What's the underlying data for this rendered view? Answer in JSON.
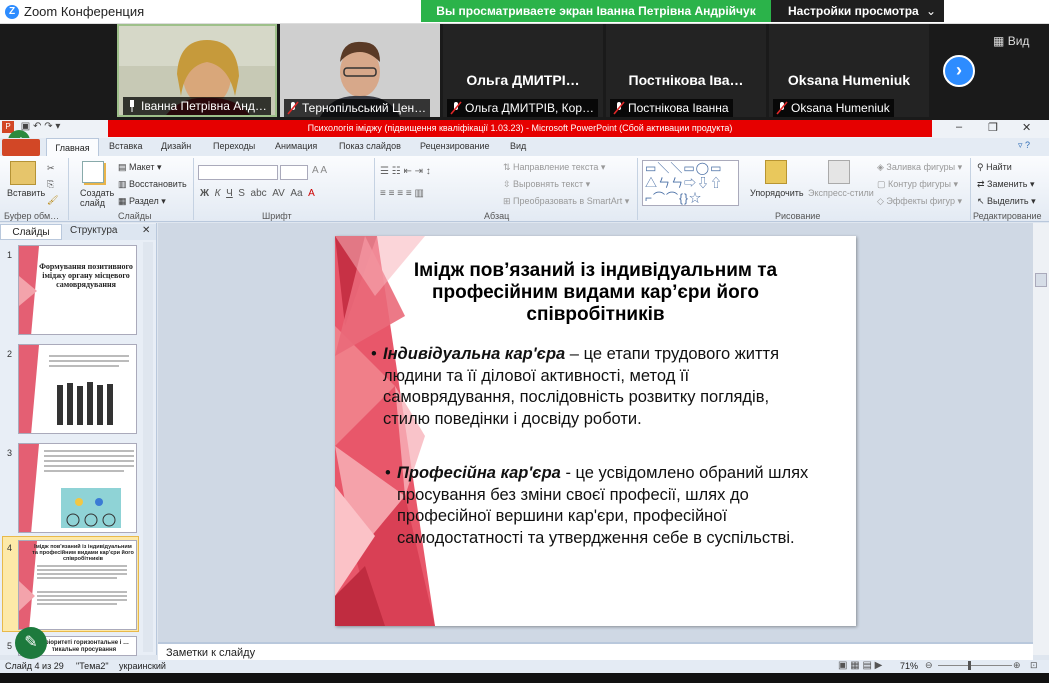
{
  "zoom": {
    "title": "Zoom Конференция",
    "share_banner": "Вы просматриваете экран Іванна Петрівна Андрійчук",
    "view_options": "Настройки просмотра",
    "view_button": "Вид",
    "participants": [
      {
        "caption": "Іванна Петрівна Анд…",
        "video": true
      },
      {
        "caption": "Тернопільський Цен…",
        "video": true
      },
      {
        "name": "Ольга ДМИТРІ…",
        "caption": "Ольга ДМИТРІВ, Кор…"
      },
      {
        "name": "Постнікова Іва…",
        "caption": "Постнікова Іванна"
      },
      {
        "name": "Oksana Humeniuk",
        "caption": "Oksana Humeniuk"
      }
    ]
  },
  "ppt": {
    "window_title": "Психологія іміджу (підвищення кваліфікації 1.03.23) - Microsoft PowerPoint (Сбой активации продукта)",
    "tabs": [
      "Главная",
      "Вставка",
      "Дизайн",
      "Переходы",
      "Анимация",
      "Показ слайдов",
      "Рецензирование",
      "Вид"
    ],
    "groups": {
      "clipboard": "Буфер обм…",
      "slides": "Слайды",
      "font": "Шрифт",
      "paragraph": "Абзац",
      "drawing": "Рисование",
      "editing": "Редактирование"
    },
    "buttons": {
      "paste": "Вставить",
      "new_slide": "Создать слайд",
      "layout": "Макет",
      "reset": "Восстановить",
      "section": "Раздел",
      "text_direction": "Направление текста",
      "align_text": "Выровнять текст",
      "smartart": "Преобразовать в SmartArt",
      "arrange": "Упорядочить",
      "quick_styles": "Экспресс-стили",
      "shape_fill": "Заливка фигуры",
      "shape_outline": "Контур фигуры",
      "shape_effects": "Эффекты фигур",
      "find": "Найти",
      "replace": "Заменить",
      "select": "Выделить"
    },
    "panel_tabs": [
      "Слайды",
      "Структура"
    ],
    "thumbnails": [
      {
        "num": "1",
        "title": "Формування позитивного іміджу органу місцевого самоврядування"
      },
      {
        "num": "2",
        "title": ""
      },
      {
        "num": "3",
        "title": ""
      },
      {
        "num": "4",
        "title": "Імідж пов'язаний із індивідуальним та професійним видами кар'єри його співробітників"
      },
      {
        "num": "5",
        "title": "…ріоритеті горизонтальне і …тикальне просування"
      }
    ],
    "slide": {
      "title": "Імідж пов’язаний  із індивідуальним та професійним  видами кар’єри його співробітників",
      "bullet1_term": "Індивідуальна кар'єра",
      "bullet1_text": " – це етапи трудового життя людини та її ділової активності, метод її самоврядування, послідовність розвитку поглядів, стилю поведінки і досвіду роботи.",
      "bullet2_term": "Професійна кар'єра",
      "bullet2_text": " - це усвідомлено обраний шлях просування без зміни своєї професії, шлях до професійної вершини кар'єри, професійної самодостатності та утвердження себе в суспільстві."
    },
    "notes_placeholder": "Заметки к слайду",
    "status": {
      "slide": "Слайд 4 из 29",
      "theme": "\"Тема2\"",
      "language": "украинский",
      "zoom": "71%"
    },
    "colors": {
      "accent_red": "#e60000",
      "slide_pink": "#e8576a"
    }
  }
}
